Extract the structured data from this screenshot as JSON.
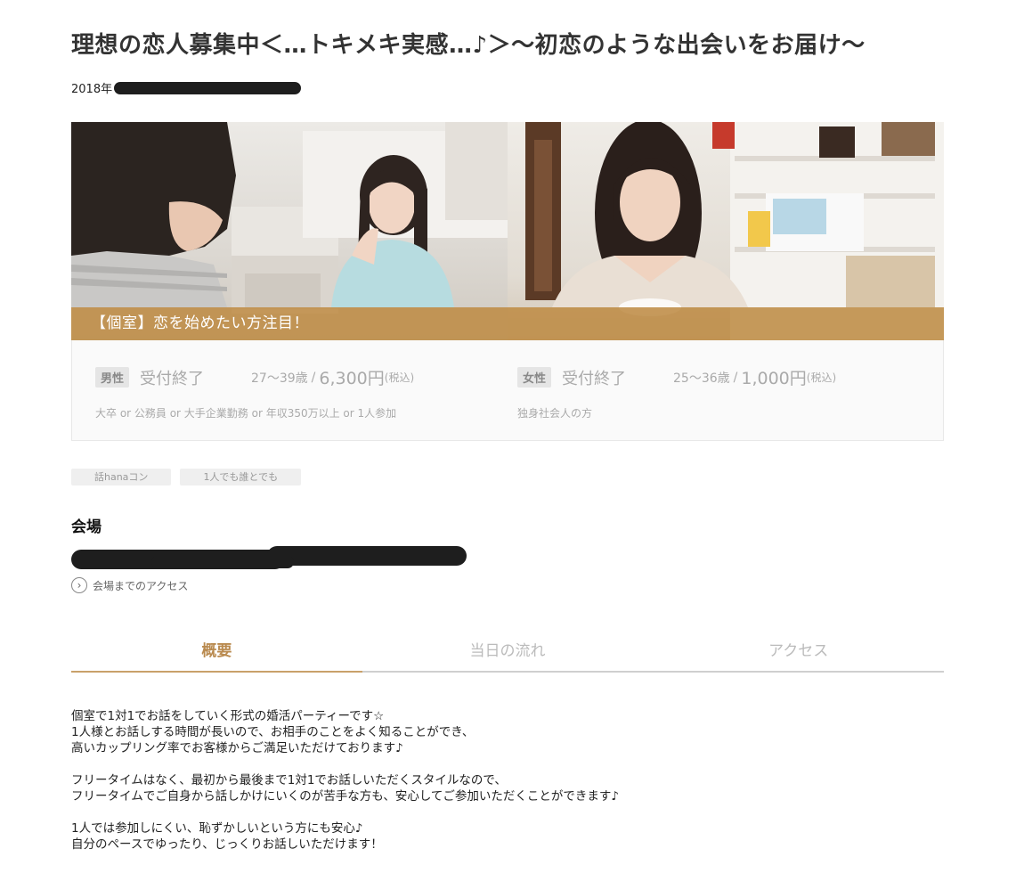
{
  "page": {
    "title": "理想の恋人募集中＜…トキメキ実感…♪＞～初恋のような出会いをお届け～",
    "date_prefix": "2018年"
  },
  "hero": {
    "caption": "【個室】恋を始めたい方注目！"
  },
  "tickets": {
    "male": {
      "badge": "男性",
      "status": "受付終了",
      "age": "27～39歳",
      "separator": "/",
      "price": "6,300円",
      "tax": "(税込)",
      "condition": "大卒 or 公務員 or 大手企業勤務 or 年収350万以上 or 1人参加"
    },
    "female": {
      "badge": "女性",
      "status": "受付終了",
      "age": "25～36歳",
      "separator": "/",
      "price": "1,000円",
      "tax": "(税込)",
      "condition": "独身社会人の方"
    }
  },
  "tags": [
    "話hanaコン",
    "1人でも誰とでも"
  ],
  "venue": {
    "heading": "会場",
    "access_label": "会場までのアクセス",
    "access_icon": "chevron-right-circle-icon"
  },
  "tabs": [
    {
      "label": "概要",
      "active": true
    },
    {
      "label": "当日の流れ",
      "active": false
    },
    {
      "label": "アクセス",
      "active": false
    }
  ],
  "description": {
    "lines": [
      "個室で1対1でお話をしていく形式の婚活パーティーです☆",
      "1人様とお話しする時間が長いので、お相手のことをよく知ることができ、",
      "高いカップリング率でお客様からご満足いただけております♪",
      "",
      "フリータイムはなく、最初から最後まで1対1でお話しいただくスタイルなので、",
      "フリータイムでご自身から話しかけにいくのが苦手な方も、安心してご参加いただくことができます♪",
      "",
      "1人では参加しにくい、恥ずかしいという方にも安心♪",
      "自分のペースでゆったり、じっくりお話しいただけます！"
    ]
  },
  "colors": {
    "accent": "#b98a4f",
    "caption_bg": "#be8c46",
    "muted_text": "#aaaaaa"
  }
}
